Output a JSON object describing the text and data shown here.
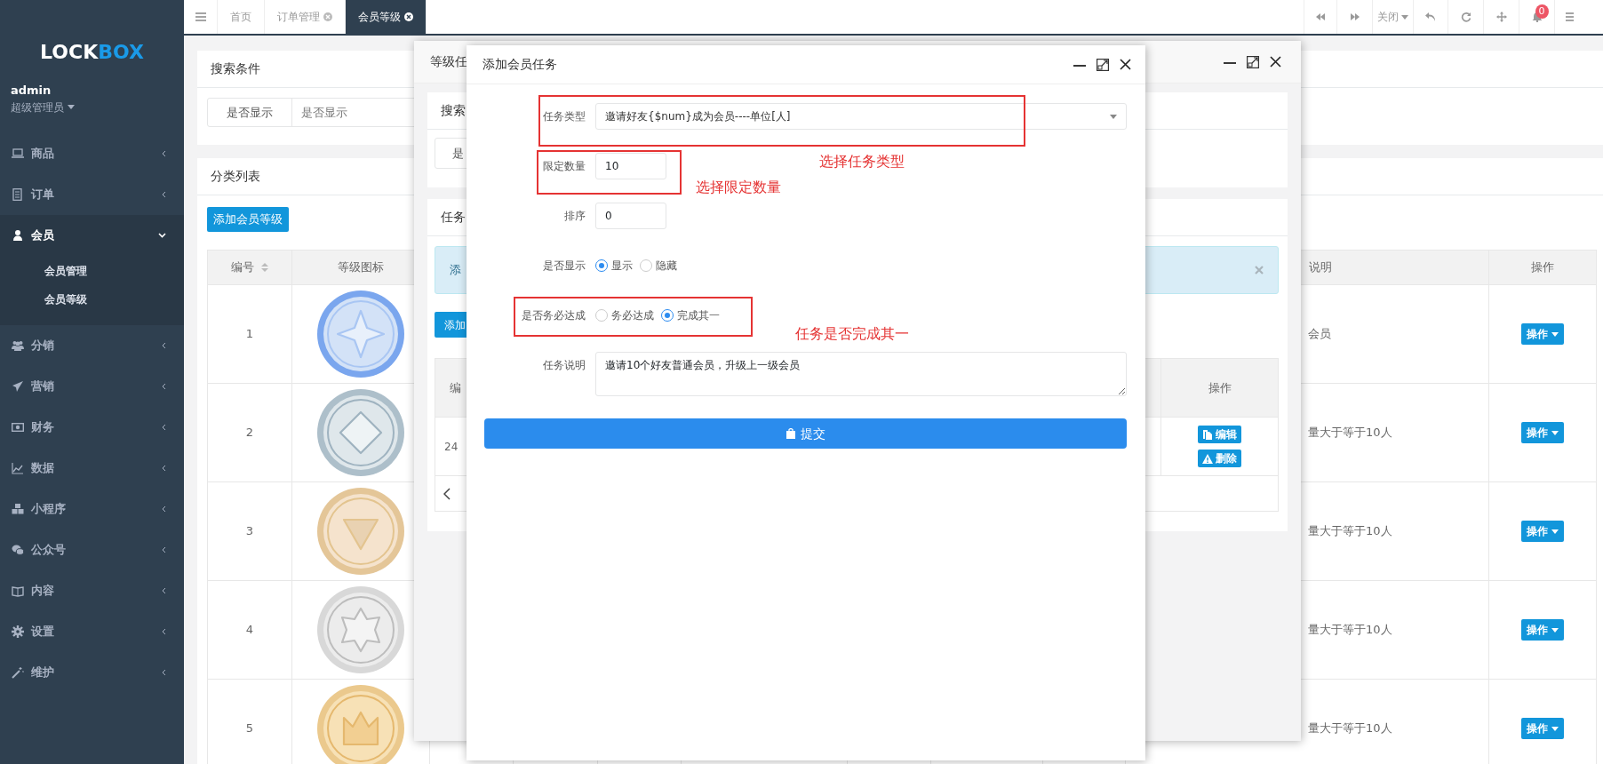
{
  "sidebar": {
    "logo": [
      "LOCK",
      "BOX"
    ],
    "user": {
      "name": "admin",
      "role": "超级管理员"
    },
    "menu": [
      {
        "label": "商品",
        "expanded": false
      },
      {
        "label": "订单",
        "expanded": false
      },
      {
        "label": "会员",
        "expanded": true,
        "children": [
          {
            "label": "会员管理"
          },
          {
            "label": "会员等级"
          }
        ]
      },
      {
        "label": "分销",
        "expanded": false
      },
      {
        "label": "营销",
        "expanded": false
      },
      {
        "label": "财务",
        "expanded": false
      },
      {
        "label": "数据",
        "expanded": false
      },
      {
        "label": "小程序",
        "expanded": false
      },
      {
        "label": "公众号",
        "expanded": false
      },
      {
        "label": "内容",
        "expanded": false
      },
      {
        "label": "设置",
        "expanded": false
      },
      {
        "label": "维护",
        "expanded": false
      }
    ]
  },
  "topbar": {
    "tabs": [
      {
        "label": "首页",
        "selected": false,
        "closable": false
      },
      {
        "label": "订单管理",
        "selected": false,
        "closable": true
      },
      {
        "label": "会员等级",
        "selected": true,
        "closable": true
      }
    ],
    "close_menu": "关闭",
    "notification_count": "0"
  },
  "page": {
    "search_card": {
      "title": "搜索条件",
      "filter_label": "是否显示",
      "filter_value": "是否显示"
    },
    "list_card": {
      "title": "分类列表",
      "add_button": "添加会员等级",
      "columns": {
        "id": "编号",
        "icon": "等级图标",
        "description": "说明",
        "actions": "操作"
      },
      "rows": [
        {
          "id": "1",
          "description": "会员",
          "action": "操作"
        },
        {
          "id": "2",
          "description": "量大于等于10人",
          "action": "操作"
        },
        {
          "id": "3",
          "description": "量大于等于10人",
          "action": "操作"
        },
        {
          "id": "4",
          "description": "量大于等于10人",
          "action": "操作"
        },
        {
          "id": "5",
          "description": "量大于等于10人",
          "action": "操作"
        }
      ]
    }
  },
  "task_list_dialog": {
    "title": "等级任",
    "search_title": "搜索",
    "filter_label": "是",
    "list_title": "任务",
    "alert_text": "添",
    "add_button": "添加",
    "columns": {
      "id": "编",
      "actions": "操作"
    },
    "rows": [
      {
        "id": "24",
        "edit": "编辑",
        "delete": "删除"
      }
    ]
  },
  "add_task_dialog": {
    "title": "添加会员任务",
    "fields": [
      {
        "kind": "select",
        "label": "任务类型",
        "value": "邀请好友{$num}成为会员----单位[人]"
      },
      {
        "kind": "input",
        "label": "限定数量",
        "value": "10"
      },
      {
        "kind": "input",
        "label": "排序",
        "value": "0"
      },
      {
        "kind": "radio",
        "label": "是否显示",
        "options": [
          {
            "label": "显示",
            "selected": true
          },
          {
            "label": "隐藏",
            "selected": false
          }
        ]
      },
      {
        "kind": "radio",
        "label": "是否务必达成",
        "options": [
          {
            "label": "务必达成",
            "selected": false
          },
          {
            "label": "完成其一",
            "selected": true
          }
        ]
      },
      {
        "kind": "textarea",
        "label": "任务说明",
        "value": "邀请10个好友普通会员，升级上一级会员"
      }
    ],
    "submit": "提交"
  },
  "annotations": [
    {
      "text": "选择任务类型"
    },
    {
      "text": "选择限定数量"
    },
    {
      "text": "任务是否完成其一"
    }
  ]
}
